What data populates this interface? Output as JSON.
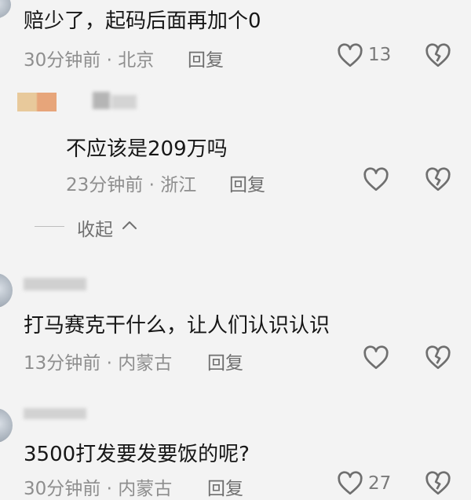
{
  "comments": [
    {
      "id": "c1",
      "text": "赔少了，起码后面再加个0",
      "meta": "30分钟前 · 北京",
      "reply_label": "回复",
      "like_count": "13"
    },
    {
      "id": "c2",
      "text": "不应该是209万吗",
      "meta": "23分钟前 · 浙江",
      "reply_label": "回复",
      "like_count": ""
    },
    {
      "id": "c3",
      "text": "打马赛克干什么，让人们认识认识",
      "meta": "13分钟前 · 内蒙古",
      "reply_label": "回复",
      "like_count": ""
    },
    {
      "id": "c4",
      "text": "3500打发要发要饭的呢?",
      "meta": "30分钟前 · 内蒙古",
      "reply_label": "回复",
      "like_count": "27"
    }
  ],
  "collapse": {
    "label": "收起"
  },
  "colors": {
    "background": "#f3f3f3",
    "text": "#161616",
    "meta": "#8e8e8e",
    "icon": "#6f6f6f"
  },
  "icons": {
    "like": "heart-outline-icon",
    "dislike": "broken-heart-icon",
    "collapse": "chevron-up-icon"
  }
}
